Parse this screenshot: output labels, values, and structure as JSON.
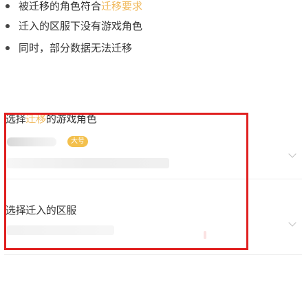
{
  "requirements": {
    "items": [
      {
        "prefix": "被迁移的角色符合",
        "highlight": "迁移要求"
      },
      {
        "text": "迁入的区服下没有游戏角色"
      },
      {
        "text": "同时，部分数据无法迁移"
      }
    ]
  },
  "role_select": {
    "title_prefix": "选择",
    "title_highlight": "迁移",
    "title_suffix": "的游戏角色",
    "badge": "大号"
  },
  "server_select": {
    "title": "选择迁入的区服"
  },
  "colors": {
    "highlight": "#f0b85a",
    "badge": "#f3c04d",
    "annotation_border": "#e02020",
    "text": "#333333"
  },
  "icons": {
    "bullet": "bullet-dot-icon",
    "row_arrow": "chevron-down-icon"
  }
}
